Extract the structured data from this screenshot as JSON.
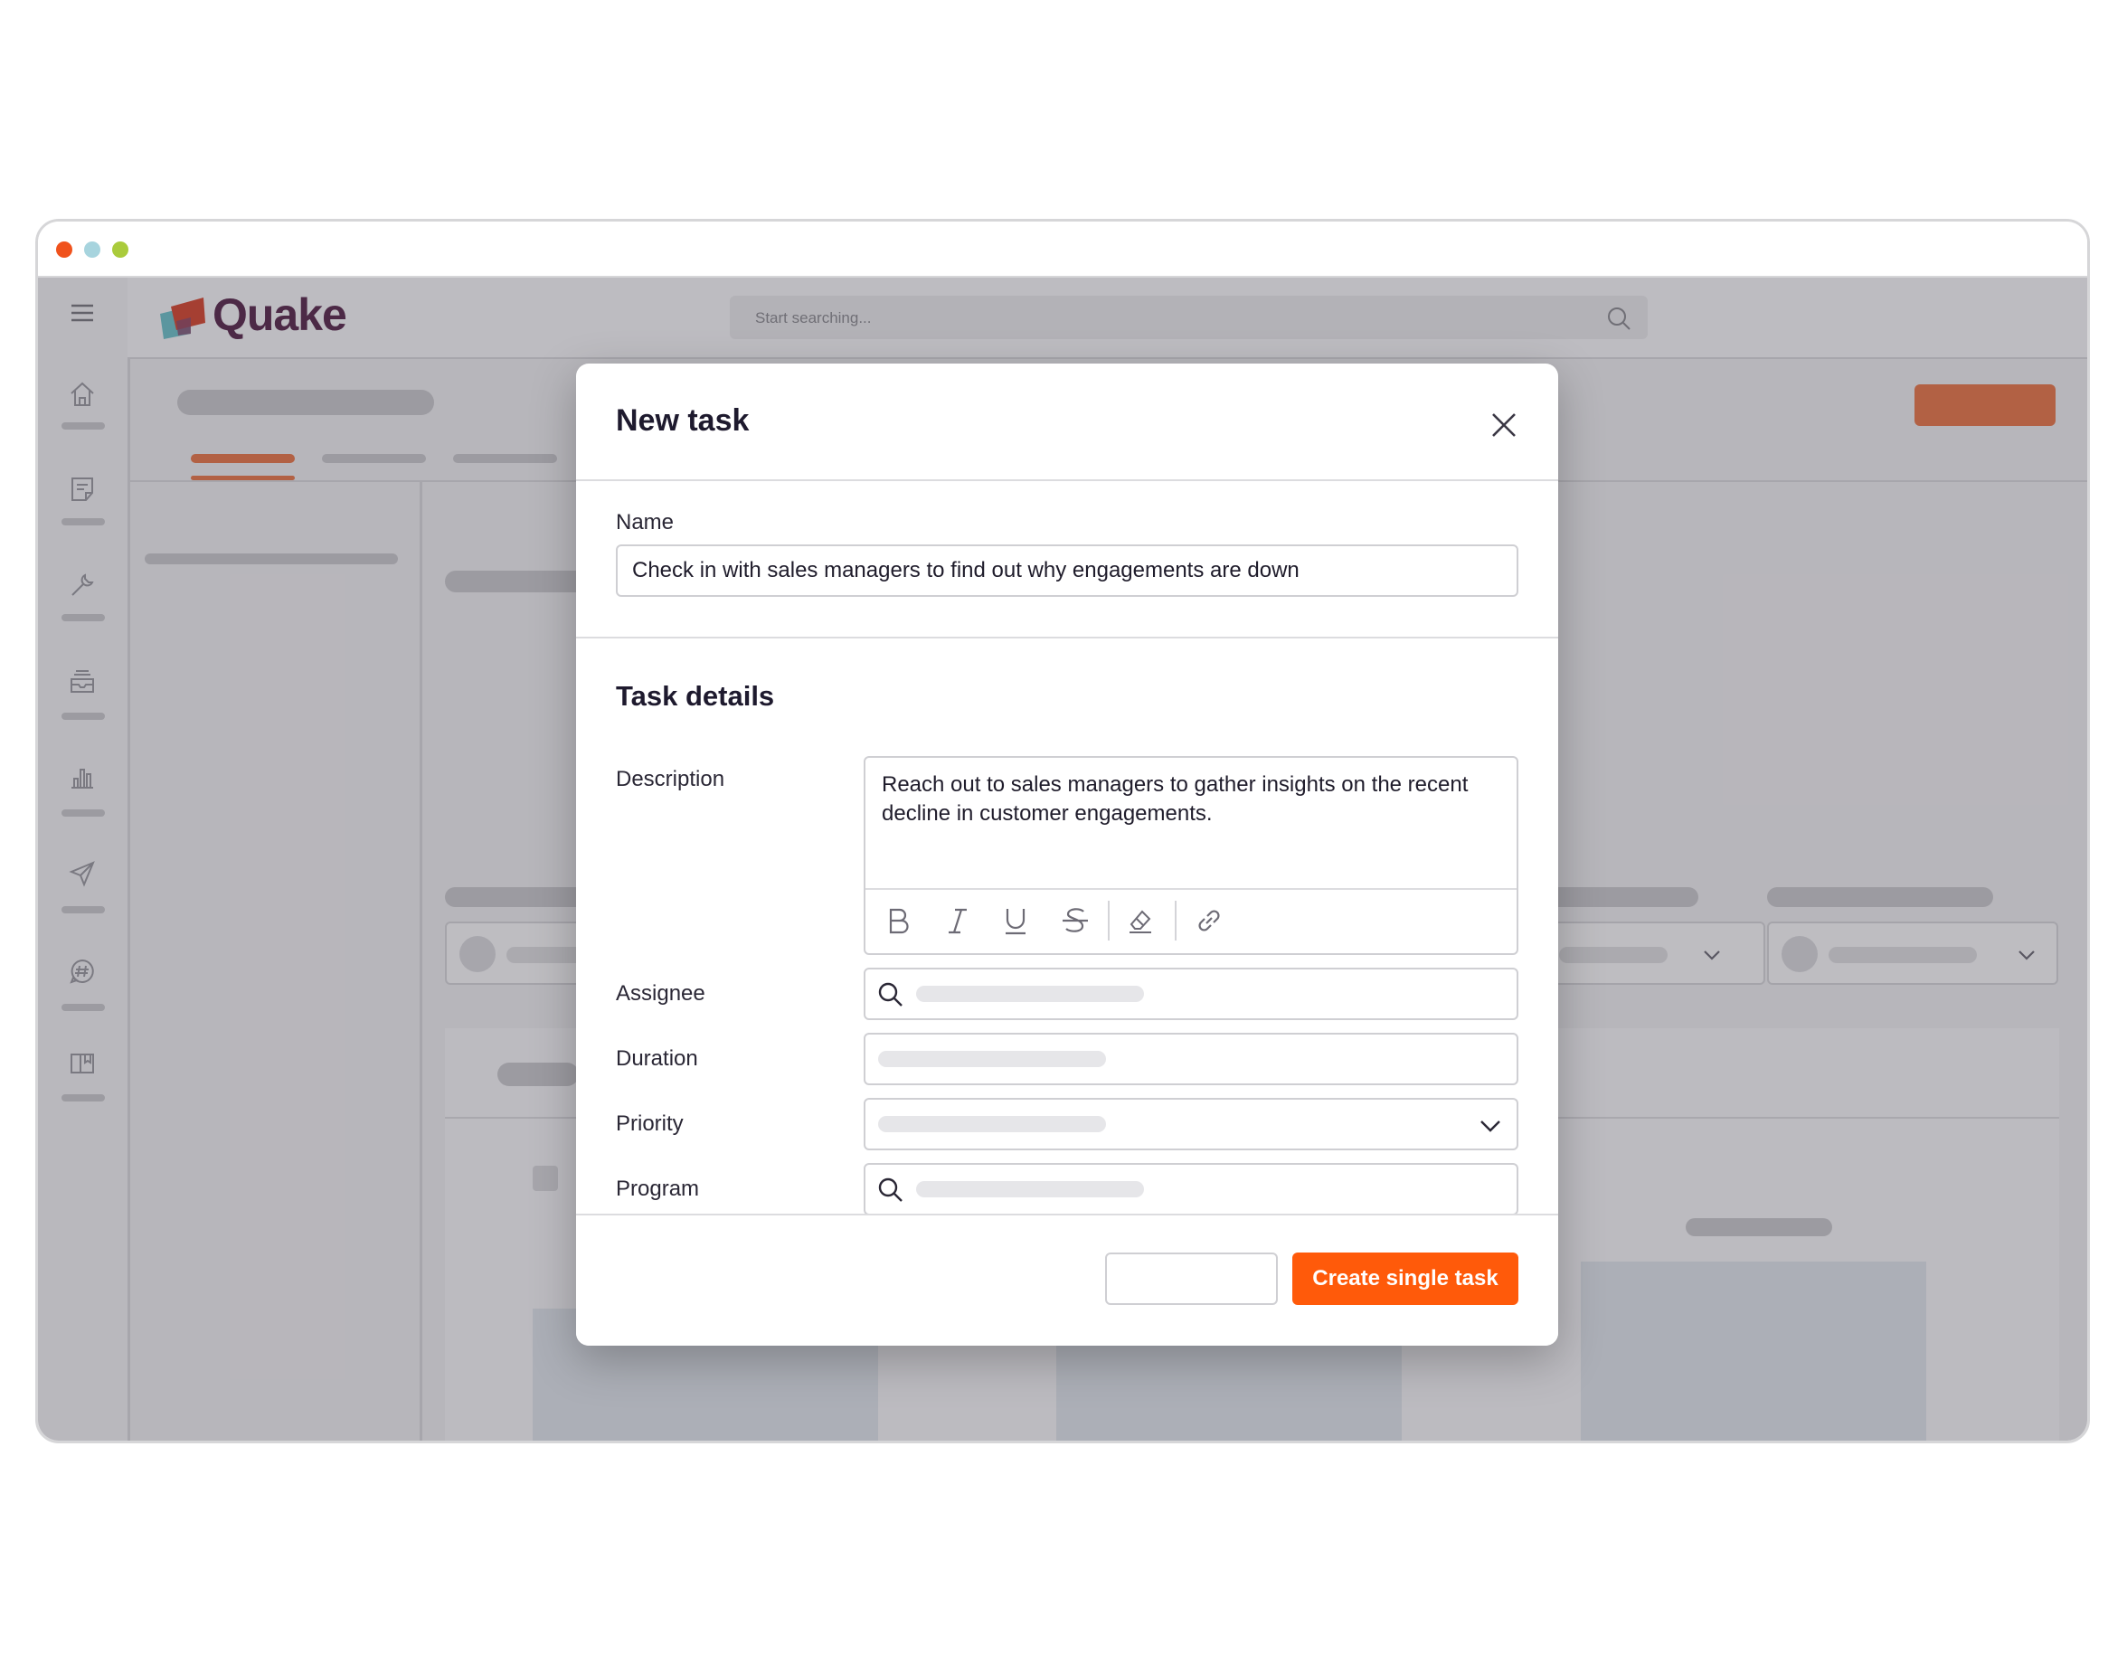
{
  "window": {
    "traffic_lights": [
      "#f0521c",
      "#a7d4de",
      "#aacb3c"
    ]
  },
  "header": {
    "brand": "Quake",
    "search": {
      "placeholder": "Start searching..."
    },
    "colors": {
      "brand_text": "#5a2b4e",
      "accent": "#e8794c"
    }
  },
  "sidebar": {
    "icons": [
      "menu-icon",
      "home-icon",
      "notes-icon",
      "wrench-icon",
      "inbox-icon",
      "bar-chart-icon",
      "send-icon",
      "chat-hash-icon",
      "book-icon"
    ]
  },
  "modal": {
    "title": "New task",
    "name_label": "Name",
    "name_value": "Check in with sales managers to find out why engagements are down",
    "section_title": "Task details",
    "fields": {
      "description_label": "Description",
      "description_value": "Reach out to sales managers to gather insights on the recent decline in customer engagements.",
      "assignee_label": "Assignee",
      "duration_label": "Duration",
      "priority_label": "Priority",
      "program_label": "Program"
    },
    "toolbar": [
      "bold-icon",
      "italic-icon",
      "underline-icon",
      "strikethrough-icon",
      "eraser-icon",
      "link-icon"
    ],
    "primary_button": "Create single task",
    "colors": {
      "primary": "#ff5a0a"
    }
  }
}
